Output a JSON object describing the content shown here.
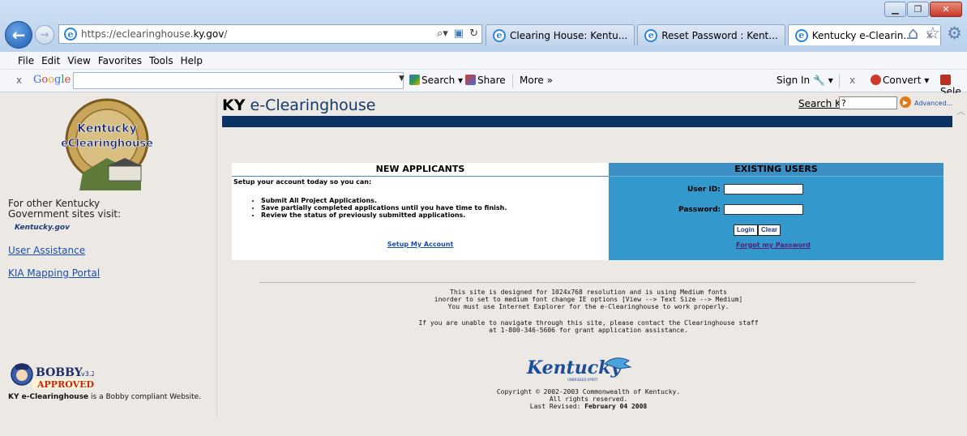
{
  "browser": {
    "url_prefix": "https://eclearinghouse.",
    "url_domain": "ky.gov",
    "url_suffix": "/",
    "tabs": [
      {
        "label": "Clearing House: Kentu..."
      },
      {
        "label": "Reset Password : Kent..."
      },
      {
        "label": "Kentucky e-Clearin..."
      }
    ],
    "menu": [
      "File",
      "Edit",
      "View",
      "Favorites",
      "Tools",
      "Help"
    ],
    "toolbar": {
      "google": [
        "G",
        "o",
        "o",
        "g",
        "l",
        "e"
      ],
      "search": "Search",
      "share": "Share",
      "more": "More »",
      "signin": "Sign In",
      "convert": "Convert",
      "select": "Sele"
    }
  },
  "page": {
    "title_bold": "KY",
    "title_rest": " e-Clearinghouse",
    "search_label": "Search KY:",
    "search_value": "?",
    "advanced": "Advanced...",
    "seal_text1": "Kentucky",
    "seal_text2": "eClearinghouse",
    "other_sites": [
      "For other Kentucky",
      "Government sites visit:"
    ],
    "kygov": "Kentucky.gov",
    "links": [
      "User Assistance",
      "KIA Mapping Portal"
    ],
    "bobby_label": "BOBBY",
    "bobby_version": "v3.2",
    "bobby_approved": "APPROVED",
    "bobby_text_bold": "KY e-Clearinghouse",
    "bobby_text_rest": " is a Bobby compliant Website.",
    "new_applicants": {
      "header": "NEW APPLICANTS",
      "intro": "Setup your account today so you can:",
      "items": [
        "Submit All Project Applications.",
        "Save partially completed applications until you have time to finish.",
        "Review the status of previously submitted applications."
      ],
      "link": "Setup My Account"
    },
    "existing_users": {
      "header": "EXISTING USERS",
      "user_id_label": "User ID:",
      "password_label": "Password:",
      "login": "Login",
      "clear": "Clear",
      "forgot": "Forgot my Password"
    },
    "info1": [
      "This site is designed for 1024x768 resolution and is using Medium fonts",
      "inorder to set to medium font change IE options [View --> Text Size --> Medium]",
      "You must use Internet Explorer for the e-Clearinghouse to work properly."
    ],
    "info2": [
      "If you are unable to navigate through this site, please contact the Clearinghouse staff",
      "at 1-800-346-5606 for grant application assistance."
    ],
    "ky_logo": "Kentucky",
    "ky_logo_tag": "UNBRIDLED SPIRIT",
    "copyright": [
      "Copyright © 2002-2003 Commonwealth of Kentucky.",
      "All rights reserved."
    ],
    "last_revised_label": "Last Revised: ",
    "last_revised_date": "February 04 2008"
  },
  "colors": {
    "title": "#123a6b",
    "bluebar": "#0a3264",
    "existing_bg": "#3399cc",
    "link": "#1a4ea8"
  }
}
